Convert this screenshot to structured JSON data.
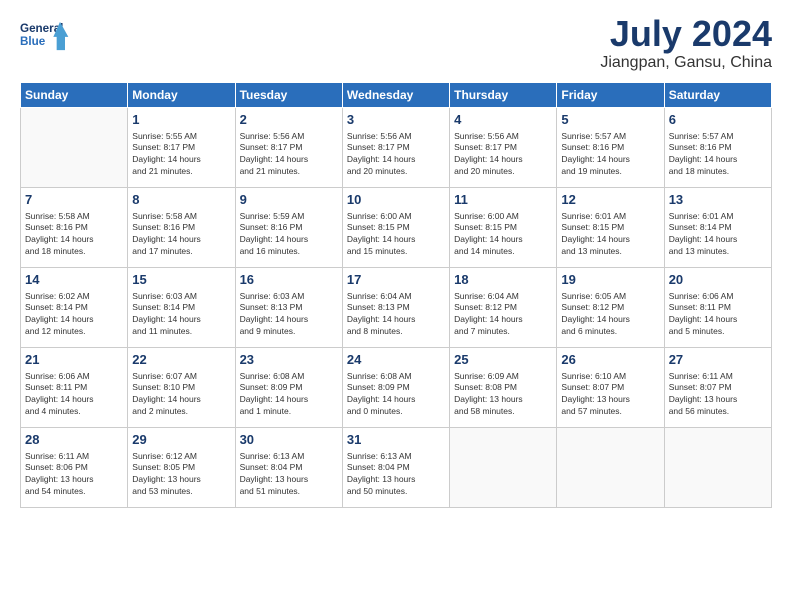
{
  "header": {
    "logo_line1": "General",
    "logo_line2": "Blue",
    "month": "July 2024",
    "location": "Jiangpan, Gansu, China"
  },
  "weekdays": [
    "Sunday",
    "Monday",
    "Tuesday",
    "Wednesday",
    "Thursday",
    "Friday",
    "Saturday"
  ],
  "weeks": [
    [
      {
        "day": "",
        "info": ""
      },
      {
        "day": "1",
        "info": "Sunrise: 5:55 AM\nSunset: 8:17 PM\nDaylight: 14 hours\nand 21 minutes."
      },
      {
        "day": "2",
        "info": "Sunrise: 5:56 AM\nSunset: 8:17 PM\nDaylight: 14 hours\nand 21 minutes."
      },
      {
        "day": "3",
        "info": "Sunrise: 5:56 AM\nSunset: 8:17 PM\nDaylight: 14 hours\nand 20 minutes."
      },
      {
        "day": "4",
        "info": "Sunrise: 5:56 AM\nSunset: 8:17 PM\nDaylight: 14 hours\nand 20 minutes."
      },
      {
        "day": "5",
        "info": "Sunrise: 5:57 AM\nSunset: 8:16 PM\nDaylight: 14 hours\nand 19 minutes."
      },
      {
        "day": "6",
        "info": "Sunrise: 5:57 AM\nSunset: 8:16 PM\nDaylight: 14 hours\nand 18 minutes."
      }
    ],
    [
      {
        "day": "7",
        "info": "Sunrise: 5:58 AM\nSunset: 8:16 PM\nDaylight: 14 hours\nand 18 minutes."
      },
      {
        "day": "8",
        "info": "Sunrise: 5:58 AM\nSunset: 8:16 PM\nDaylight: 14 hours\nand 17 minutes."
      },
      {
        "day": "9",
        "info": "Sunrise: 5:59 AM\nSunset: 8:16 PM\nDaylight: 14 hours\nand 16 minutes."
      },
      {
        "day": "10",
        "info": "Sunrise: 6:00 AM\nSunset: 8:15 PM\nDaylight: 14 hours\nand 15 minutes."
      },
      {
        "day": "11",
        "info": "Sunrise: 6:00 AM\nSunset: 8:15 PM\nDaylight: 14 hours\nand 14 minutes."
      },
      {
        "day": "12",
        "info": "Sunrise: 6:01 AM\nSunset: 8:15 PM\nDaylight: 14 hours\nand 13 minutes."
      },
      {
        "day": "13",
        "info": "Sunrise: 6:01 AM\nSunset: 8:14 PM\nDaylight: 14 hours\nand 13 minutes."
      }
    ],
    [
      {
        "day": "14",
        "info": "Sunrise: 6:02 AM\nSunset: 8:14 PM\nDaylight: 14 hours\nand 12 minutes."
      },
      {
        "day": "15",
        "info": "Sunrise: 6:03 AM\nSunset: 8:14 PM\nDaylight: 14 hours\nand 11 minutes."
      },
      {
        "day": "16",
        "info": "Sunrise: 6:03 AM\nSunset: 8:13 PM\nDaylight: 14 hours\nand 9 minutes."
      },
      {
        "day": "17",
        "info": "Sunrise: 6:04 AM\nSunset: 8:13 PM\nDaylight: 14 hours\nand 8 minutes."
      },
      {
        "day": "18",
        "info": "Sunrise: 6:04 AM\nSunset: 8:12 PM\nDaylight: 14 hours\nand 7 minutes."
      },
      {
        "day": "19",
        "info": "Sunrise: 6:05 AM\nSunset: 8:12 PM\nDaylight: 14 hours\nand 6 minutes."
      },
      {
        "day": "20",
        "info": "Sunrise: 6:06 AM\nSunset: 8:11 PM\nDaylight: 14 hours\nand 5 minutes."
      }
    ],
    [
      {
        "day": "21",
        "info": "Sunrise: 6:06 AM\nSunset: 8:11 PM\nDaylight: 14 hours\nand 4 minutes."
      },
      {
        "day": "22",
        "info": "Sunrise: 6:07 AM\nSunset: 8:10 PM\nDaylight: 14 hours\nand 2 minutes."
      },
      {
        "day": "23",
        "info": "Sunrise: 6:08 AM\nSunset: 8:09 PM\nDaylight: 14 hours\nand 1 minute."
      },
      {
        "day": "24",
        "info": "Sunrise: 6:08 AM\nSunset: 8:09 PM\nDaylight: 14 hours\nand 0 minutes."
      },
      {
        "day": "25",
        "info": "Sunrise: 6:09 AM\nSunset: 8:08 PM\nDaylight: 13 hours\nand 58 minutes."
      },
      {
        "day": "26",
        "info": "Sunrise: 6:10 AM\nSunset: 8:07 PM\nDaylight: 13 hours\nand 57 minutes."
      },
      {
        "day": "27",
        "info": "Sunrise: 6:11 AM\nSunset: 8:07 PM\nDaylight: 13 hours\nand 56 minutes."
      }
    ],
    [
      {
        "day": "28",
        "info": "Sunrise: 6:11 AM\nSunset: 8:06 PM\nDaylight: 13 hours\nand 54 minutes."
      },
      {
        "day": "29",
        "info": "Sunrise: 6:12 AM\nSunset: 8:05 PM\nDaylight: 13 hours\nand 53 minutes."
      },
      {
        "day": "30",
        "info": "Sunrise: 6:13 AM\nSunset: 8:04 PM\nDaylight: 13 hours\nand 51 minutes."
      },
      {
        "day": "31",
        "info": "Sunrise: 6:13 AM\nSunset: 8:04 PM\nDaylight: 13 hours\nand 50 minutes."
      },
      {
        "day": "",
        "info": ""
      },
      {
        "day": "",
        "info": ""
      },
      {
        "day": "",
        "info": ""
      }
    ]
  ]
}
